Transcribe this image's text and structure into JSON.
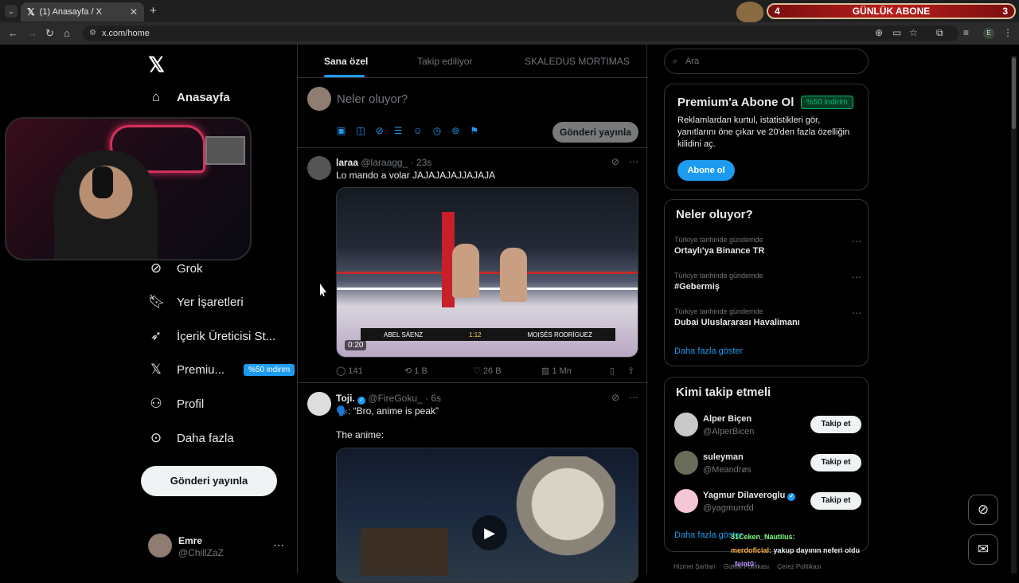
{
  "browser": {
    "tab_title": "(1) Anasayfa / X",
    "url": "x.com/home",
    "tab_list_icon": "⌄",
    "new_tab_icon": "+",
    "profile_initial": "E"
  },
  "overlay": {
    "abone_left": "4",
    "abone_title": "GÜNLÜK ABONE",
    "abone_right": "3"
  },
  "sidebar": {
    "home": "Anasayfa",
    "grok": "Grok",
    "bookmarks": "Yer İşaretleri",
    "creator": "İçerik Üreticisi St...",
    "premium": "Premiu...",
    "premium_badge": "%50 indirim",
    "profile": "Profil",
    "more": "Daha fazla",
    "post_button": "Gönderi yayınla",
    "account_name": "Emre",
    "account_handle": "@ChillZaZ"
  },
  "feed": {
    "tabs": [
      "Sana özel",
      "Takip ediliyor",
      "SKALEDUS MORTIMAS"
    ],
    "composer_placeholder": "Neler oluyor?",
    "composer_post": "Gönderi yayınla",
    "tweets": [
      {
        "name": "laraa",
        "handle": "@laraagg_",
        "time": "23s",
        "text": "Lo mando a volar JAJAJAJAJJAJAJA",
        "video_time": "0:20",
        "score_left": "ABEL SÁENZ",
        "score_time": "1:12",
        "score_right": "MOISÉS RODRÍGUEZ",
        "replies": "141",
        "reposts": "1 B",
        "likes": "26 B",
        "views": "1 Mn"
      },
      {
        "name": "Toji.",
        "handle": "@FireGoku_",
        "time": "6s",
        "text": "🗣️: “Bro, anime is peak”",
        "text2": "The anime:"
      }
    ]
  },
  "right": {
    "search_placeholder": "Ara",
    "premium_title": "Premium'a Abone Ol",
    "premium_badge": "%50 indirim",
    "premium_desc": "Reklamlardan kurtul, istatistikleri gör, yanıtlarını öne çıkar ve 20'den fazla özelliğin kilidini aç.",
    "premium_btn": "Abone ol",
    "trends_title": "Neler oluyor?",
    "trends": [
      {
        "context": "Türkiye tarihinde gündemde",
        "topic": "Ortaylı'ya Binance TR"
      },
      {
        "context": "Türkiye tarihinde gündemde",
        "topic": "#Gebermiş"
      },
      {
        "context": "Türkiye tarihinde gündemde",
        "topic": "Dubai Uluslararası Havalimanı"
      }
    ],
    "show_more": "Daha fazla göster",
    "follow_title": "Kimi takip etmeli",
    "follows": [
      {
        "name": "Alper Biçen",
        "handle": "@AlperBicen",
        "btn": "Takip et"
      },
      {
        "name": "suleyman",
        "handle": "@Meandrøs",
        "btn": "Takip et"
      },
      {
        "name": "Yagmur Dilaveroglu",
        "handle": "@yagmurrdd",
        "btn": "Takip et"
      }
    ],
    "follow_more": "Daha fazla göster",
    "footer": [
      "Hizmet Şartları",
      "Gizlilik Politikası",
      "Çerez Politikası"
    ]
  },
  "chat": [
    {
      "user": "31Ceken_Nautilus:",
      "msg": ""
    },
    {
      "user": "merdoficial:",
      "msg": "yakup dayının neferi oldu"
    },
    {
      "user": "_feint0:",
      "msg": ""
    }
  ],
  "colors": {
    "accent": "#1d9bf0",
    "background": "#000000",
    "border": "#2f3336",
    "muted": "#71767b"
  }
}
